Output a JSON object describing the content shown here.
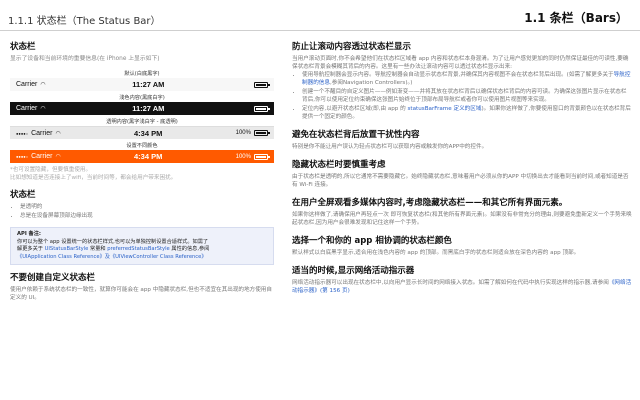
{
  "header": {
    "left_title": "1.1.1   状态栏（The Status Bar）",
    "right_title": "1.1   条栏（Bars）"
  },
  "left": {
    "section1": {
      "title": "状态栏",
      "subtitle": "显示了设备和当前环境的重要信息(在 iPhone 上显示如下)"
    },
    "bars": [
      {
        "caption": "默认(白底黑字)",
        "carrier": "Carrier",
        "time": "11:27 AM",
        "right_text": "",
        "style": "light"
      },
      {
        "caption": "浅色内容(黑底白字)",
        "carrier": "Carrier",
        "time": "11:27 AM",
        "right_text": "",
        "style": "dark"
      },
      {
        "caption": "透明内容(黑字浅白字 - 底透明)",
        "carrier": "Carrier",
        "time": "4:34 PM",
        "right_text": "100%",
        "style": "trans"
      },
      {
        "caption": "设置不同颜色",
        "carrier": "Carrier",
        "time": "4:34 PM",
        "right_text": "100%",
        "style": "orange"
      }
    ],
    "footnote": "*也可设置隐藏，但要慎重使用。\n比如想知道是否连接上了wifi，当前时间等，都会给用户带来困扰。",
    "section2": {
      "title": "状态栏",
      "bullets": [
        "是透明的",
        "总是在设备屏幕顶部边缘出现"
      ]
    },
    "note": {
      "title": "API 备注:",
      "line1": "你可以为整个 app 设置统一的状态栏样式,也可以为单独控制设置合适样式。如需了",
      "line2_prefix": "解更多关于 ",
      "link1": "UIStatusBarStyle",
      "line2_mid": " 常量和 ",
      "link2": "preferredStatusBarStyle",
      "line2_suffix": " 属性的信息,参阅",
      "line3": "《UIApplication Class Reference》及《UIViewController Class Reference》"
    },
    "section3": {
      "title": "不要创建自定义状态栏",
      "text": "使用户依赖于系统状态栏的一致性，就算你可能会在 app 中隐藏状态栏,但也不适宜在其出现的地方使用自定义的 UI。"
    }
  },
  "right": {
    "s1": {
      "title": "防止让滚动内容透过状态栏显示",
      "intro": "当用户滚动页面时,你不会希望他们在状态栏区域看 app 内容和状态栏本身混淆。为了让用户感觉更加的同时仍然保证最佳的可读性,要确保状态栏背景会模糊其背后的内容。这里有一些办法让滚动内容可以透过状态栏显示出来:",
      "bullets": [
        {
          "prefix": "使用导航控制器会显示内容。导航控制器会自动显示状态栏背景,并确保其内容视图不会在状态栏背后出现。(如需了解更多关于",
          "link": "导航控制器的信息",
          "suffix": ",参阅Navigation Controllers)。)"
        },
        {
          "prefix": "创建一个不醒目的自定义图片——例如渐变——并将其放在状态栏背后以确保状态栏背后的内容可读。为确保这张图片显示在状态栏背后,你可以使用定位约束确保这张图片始终位于顶部布局导航栏或者你可以使用图片视图等来实现。",
          "link": "",
          "suffix": ""
        },
        {
          "prefix": "定位内容,以避开状态栏区域(即,由 app 的 ",
          "link": "statusBarFrame 定义的区域",
          "suffix": ")。如果你这样做了,你要使用窗口的背景颜色以在状态栏背后提供一个固定的颜色。"
        }
      ]
    },
    "s2": {
      "title": "避免在状态栏背后放置干扰性内容",
      "text": "特别是你不能让用户误认为轻点状态栏可以获取内容或触发你的APP中的控件。"
    },
    "s3": {
      "title": "隐藏状态栏时要慎重考虑",
      "text": "由于状态栏是透明的,所以它通常不需要隐藏它。始终隐藏状态栏,意味着用户必须从你的APP 中切换出去才能看到当前时间,或者知道是否有 Wi-Fi 连接。"
    },
    "s4": {
      "title": "在用户全屏观看多媒体内容时,考虑隐藏状态栏——和其它所有界面元素。",
      "text": "如果你这样做了,请确保用户再轻点一次 即可恢复状态栏(和其他所有界面元素)。如果没有非常充分的理由,则要避免重新定义一个手势来唤起状态栏,因为用户会很难发现和记住这样一个手势。"
    },
    "s5": {
      "title": "选择一个和你的 app 相协调的状态栏颜色",
      "text": "默认样式以白底黑字显示,适合用在浅色内容的 app 的顶部。而黑底白字的状态栏则适合放在深色内容的 app 顶部。"
    },
    "s6": {
      "title": "适当的时候,显示网络活动指示器",
      "text_prefix": "网络活动指示器可以出现在状态栏中,以向用户显示长时间的网络接入状态。如需了解如何在代码中执行实现这样的指示器,请参阅",
      "link": "《网络活动指示器》(第 156 页)"
    }
  }
}
